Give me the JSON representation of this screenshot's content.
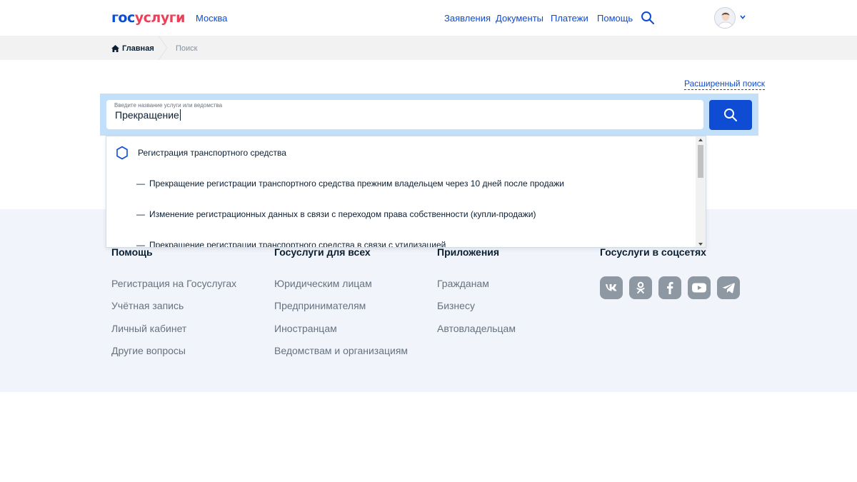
{
  "header": {
    "logo_part1": "гос",
    "logo_part2": "услуги",
    "city": "Москва",
    "nav": [
      "Заявления",
      "Документы",
      "Платежи",
      "Помощь"
    ]
  },
  "breadcrumbs": {
    "home": "Главная",
    "current": "Поиск"
  },
  "search": {
    "advanced_link": "Расширенный поиск",
    "placeholder": "Введите название услуги или ведомства",
    "value": "Прекращение"
  },
  "dropdown": {
    "group": "Регистрация транспортного средства",
    "items": [
      "Прекращение регистрации транспортного средства прежним владельцем через 10 дней после продажи",
      "Изменение регистрационных данных в связи с переходом права собственности (купли-продажи)",
      "Прекращение регистрации транспортного средства в связи с утилизацией"
    ]
  },
  "footer": {
    "columns": [
      {
        "title": "Помощь",
        "links": [
          "Регистрация на Госуслугах",
          "Учётная запись",
          "Личный кабинет",
          "Другие вопросы"
        ]
      },
      {
        "title": "Госуслуги для всех",
        "links": [
          "Юридическим лицам",
          "Предпринимателям",
          "Иностранцам",
          "Ведомствам и организациям"
        ]
      },
      {
        "title": "Приложения",
        "links": [
          "Гражданам",
          "Бизнесу",
          "Автовладельцам"
        ]
      },
      {
        "title": "Госуслуги в соцсетях",
        "links": []
      }
    ],
    "social_icons": [
      "vk-icon",
      "odnoklassniki-icon",
      "facebook-icon",
      "youtube-icon",
      "telegram-icon"
    ]
  },
  "colors": {
    "brand_blue": "#0d4cd3",
    "brand_red": "#ee3f58",
    "search_bg": "#c3e0fb",
    "footer_bg": "#f1f4fa"
  }
}
